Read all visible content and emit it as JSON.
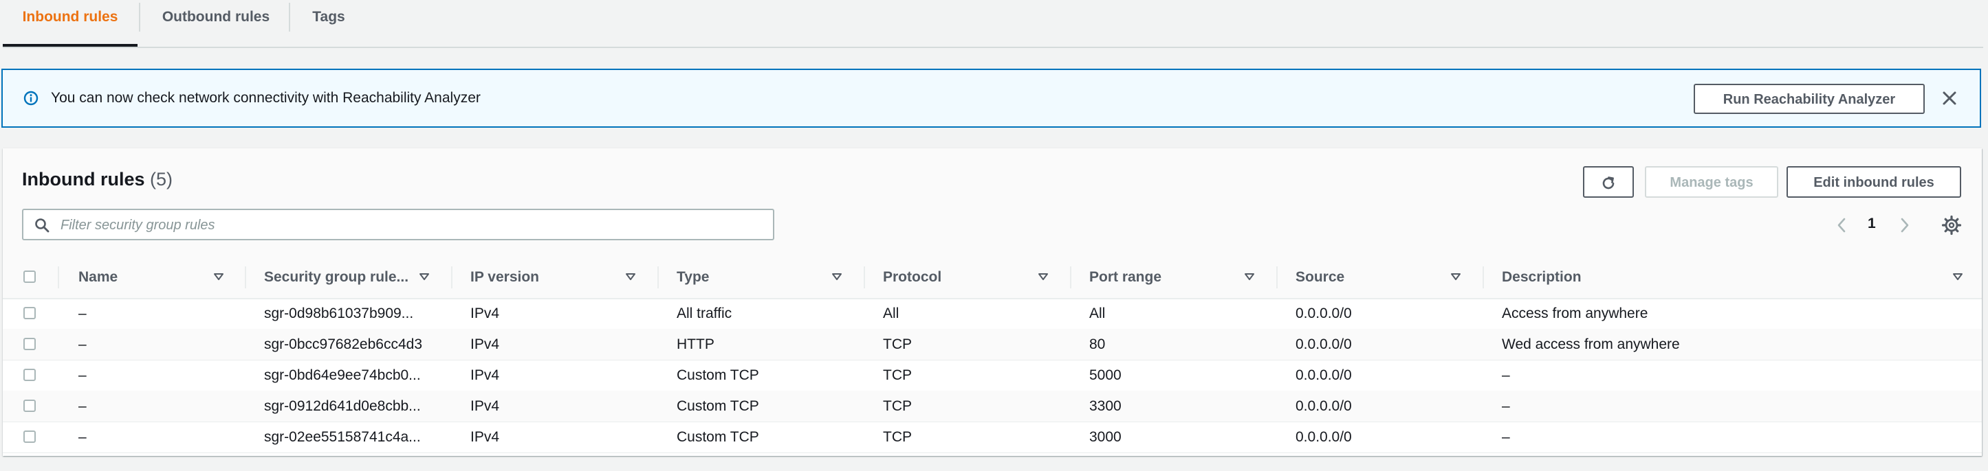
{
  "tabs": [
    {
      "label": "Inbound rules",
      "active": true
    },
    {
      "label": "Outbound rules",
      "active": false
    },
    {
      "label": "Tags",
      "active": false
    }
  ],
  "alert": {
    "icon": "info-icon",
    "text": "You can now check network connectivity with Reachability Analyzer",
    "button_label": "Run Reachability Analyzer",
    "close_icon": "close-icon"
  },
  "panel": {
    "title": "Inbound rules",
    "count": "(5)",
    "refresh_icon": "refresh-icon",
    "manage_tags_label": "Manage tags",
    "edit_label": "Edit inbound rules",
    "search_placeholder": "Filter security group rules",
    "search_value": "",
    "page": "1"
  },
  "table": {
    "columns": [
      "Name",
      "Security group rule...",
      "IP version",
      "Type",
      "Protocol",
      "Port range",
      "Source",
      "Description"
    ],
    "rows": [
      {
        "name": "–",
        "rule_id": "sgr-0d98b61037b909...",
        "ip_version": "IPv4",
        "type": "All traffic",
        "protocol": "All",
        "port_range": "All",
        "source": "0.0.0.0/0",
        "description": "Access from anywhere"
      },
      {
        "name": "–",
        "rule_id": "sgr-0bcc97682eb6cc4d3",
        "ip_version": "IPv4",
        "type": "HTTP",
        "protocol": "TCP",
        "port_range": "80",
        "source": "0.0.0.0/0",
        "description": "Wed access from anywhere"
      },
      {
        "name": "–",
        "rule_id": "sgr-0bd64e9ee74bcb0...",
        "ip_version": "IPv4",
        "type": "Custom TCP",
        "protocol": "TCP",
        "port_range": "5000",
        "source": "0.0.0.0/0",
        "description": "–"
      },
      {
        "name": "–",
        "rule_id": "sgr-0912d641d0e8cbb...",
        "ip_version": "IPv4",
        "type": "Custom TCP",
        "protocol": "TCP",
        "port_range": "3300",
        "source": "0.0.0.0/0",
        "description": "–"
      },
      {
        "name": "–",
        "rule_id": "sgr-02ee55158741c4a...",
        "ip_version": "IPv4",
        "type": "Custom TCP",
        "protocol": "TCP",
        "port_range": "3000",
        "source": "0.0.0.0/0",
        "description": "–"
      }
    ]
  },
  "colors": {
    "accent": "#ec7211",
    "info_blue": "#0073bb",
    "info_bg": "#f1faff",
    "text": "#16191f",
    "muted": "#545b64"
  }
}
